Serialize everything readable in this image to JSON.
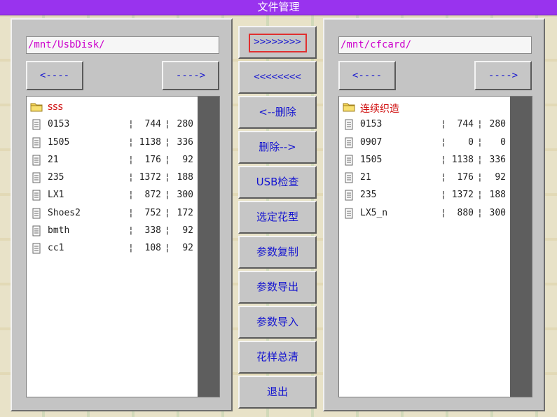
{
  "window": {
    "title": "文件管理"
  },
  "left_panel": {
    "path": "/mnt/UsbDisk/",
    "prev_label": "<----",
    "next_label": "---->",
    "items": [
      {
        "type": "folder",
        "name": "sss",
        "sep1": "",
        "size": "",
        "sep2": "",
        "len": ""
      },
      {
        "type": "file",
        "name": "0153",
        "sep1": "¦",
        "size": "744",
        "sep2": "¦",
        "len": "280"
      },
      {
        "type": "file",
        "name": "1505",
        "sep1": "¦",
        "size": "1138",
        "sep2": "¦",
        "len": "336"
      },
      {
        "type": "file",
        "name": "21",
        "sep1": "¦",
        "size": "176",
        "sep2": "¦",
        "len": "92"
      },
      {
        "type": "file",
        "name": "235",
        "sep1": "¦",
        "size": "1372",
        "sep2": "¦",
        "len": "188"
      },
      {
        "type": "file",
        "name": "LX1",
        "sep1": "¦",
        "size": "872",
        "sep2": "¦",
        "len": "300"
      },
      {
        "type": "file",
        "name": "Shoes2",
        "sep1": "¦",
        "size": "752",
        "sep2": "¦",
        "len": "172"
      },
      {
        "type": "file",
        "name": "bmth",
        "sep1": "¦",
        "size": "338",
        "sep2": "¦",
        "len": "92"
      },
      {
        "type": "file",
        "name": "cc1",
        "sep1": "¦",
        "size": "108",
        "sep2": "¦",
        "len": "92"
      }
    ]
  },
  "right_panel": {
    "path": "/mnt/cfcard/",
    "prev_label": "<----",
    "next_label": "---->",
    "items": [
      {
        "type": "folder",
        "name": "连续织造",
        "sep1": "",
        "size": "",
        "sep2": "",
        "len": ""
      },
      {
        "type": "file",
        "name": "0153",
        "sep1": "¦",
        "size": "744",
        "sep2": "¦",
        "len": "280"
      },
      {
        "type": "file",
        "name": "0907",
        "sep1": "¦",
        "size": "0",
        "sep2": "¦",
        "len": "0"
      },
      {
        "type": "file",
        "name": "1505",
        "sep1": "¦",
        "size": "1138",
        "sep2": "¦",
        "len": "336"
      },
      {
        "type": "file",
        "name": "21",
        "sep1": "¦",
        "size": "176",
        "sep2": "¦",
        "len": "92"
      },
      {
        "type": "file",
        "name": "235",
        "sep1": "¦",
        "size": "1372",
        "sep2": "¦",
        "len": "188"
      },
      {
        "type": "file",
        "name": "LX5_n",
        "sep1": "¦",
        "size": "880",
        "sep2": "¦",
        "len": "300"
      }
    ]
  },
  "center_buttons": {
    "copy_right": ">>>>>>>>",
    "copy_left": "<<<<<<<<",
    "delete_left": "<--删除",
    "delete_right": "删除-->",
    "usb_check": "USB检查",
    "select_pattern": "选定花型",
    "param_copy": "参数复制",
    "param_export": "参数导出",
    "param_import": "参数导入",
    "clear_patterns": "花样总清",
    "exit": "退出"
  },
  "colors": {
    "titlebar": "#9933ee",
    "path_text": "#cc00cc",
    "button_text": "#1515d0",
    "folder_text": "#d01010",
    "selection_ring": "#e03030"
  }
}
